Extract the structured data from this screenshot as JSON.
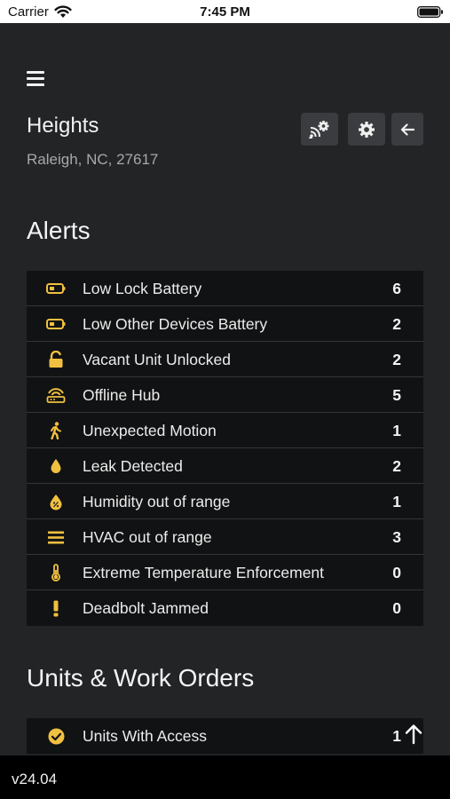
{
  "status_bar": {
    "carrier": "Carrier",
    "time": "7:45 PM"
  },
  "property": {
    "name": "Heights",
    "address": "Raleigh, NC, 27617"
  },
  "alerts": {
    "title": "Alerts",
    "items": [
      {
        "label": "Low Lock Battery",
        "count": "6",
        "icon": "battery-low-icon"
      },
      {
        "label": "Low Other Devices Battery",
        "count": "2",
        "icon": "battery-low-icon"
      },
      {
        "label": "Vacant Unit Unlocked",
        "count": "2",
        "icon": "lock-open-icon"
      },
      {
        "label": "Offline Hub",
        "count": "5",
        "icon": "hub-icon"
      },
      {
        "label": "Unexpected Motion",
        "count": "1",
        "icon": "walking-person-icon"
      },
      {
        "label": "Leak Detected",
        "count": "2",
        "icon": "water-drop-icon"
      },
      {
        "label": "Humidity out of range",
        "count": "1",
        "icon": "humidity-icon"
      },
      {
        "label": "HVAC out of range",
        "count": "3",
        "icon": "hvac-lines-icon"
      },
      {
        "label": "Extreme Temperature Enforcement",
        "count": "0",
        "icon": "thermometer-icon"
      },
      {
        "label": "Deadbolt Jammed",
        "count": "0",
        "icon": "exclamation-icon"
      }
    ]
  },
  "units": {
    "title": "Units & Work Orders",
    "items": [
      {
        "label": "Units With Access",
        "count": "1",
        "icon": "check-circle-icon"
      }
    ]
  },
  "footer": {
    "version": "v24.04"
  },
  "colors": {
    "accent": "#f0c040",
    "background": "#222426",
    "list_background": "#111213"
  }
}
